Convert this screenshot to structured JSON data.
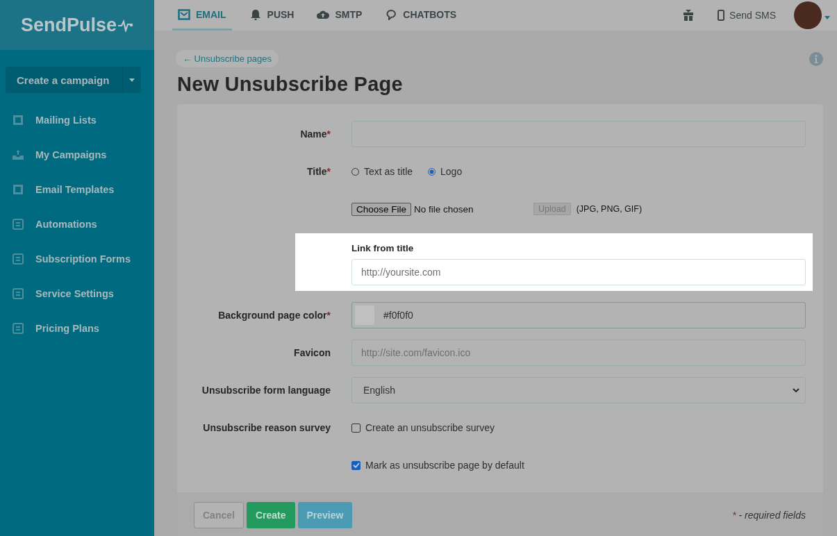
{
  "brand": {
    "name": "SendPulse"
  },
  "nav_tabs": [
    {
      "label": "EMAIL",
      "selected": true,
      "kind": "mail"
    },
    {
      "label": "PUSH",
      "selected": false,
      "kind": "bell"
    },
    {
      "label": "SMTP",
      "selected": false,
      "kind": "cloud"
    },
    {
      "label": "CHATBOTS",
      "selected": false,
      "kind": "chat"
    }
  ],
  "header": {
    "sms": "Send SMS"
  },
  "sidebar": {
    "create_button": "Create a campaign",
    "items": [
      {
        "label": "Mailing Lists",
        "kind": "lists"
      },
      {
        "label": "My Campaigns",
        "kind": "campaigns"
      },
      {
        "label": "Email Templates",
        "kind": "templates"
      },
      {
        "label": "Automations",
        "kind": "automations"
      },
      {
        "label": "Subscription Forms",
        "kind": "forms"
      },
      {
        "label": "Service Settings",
        "kind": "settings"
      },
      {
        "label": "Pricing Plans",
        "kind": "pricing"
      }
    ]
  },
  "breadcrumb": "← Unsubscribe pages",
  "title": "New Unsubscribe Page",
  "form": {
    "required_mark": "*",
    "rows": [
      {
        "kind": "text",
        "label": "Name",
        "required": true
      },
      {
        "kind": "radio",
        "label": "Title",
        "required": true,
        "options": [
          {
            "label": "Text as title",
            "selected": false
          },
          {
            "label": "Logo",
            "selected": true
          }
        ]
      },
      {
        "kind": "file",
        "choose": "Choose File",
        "status": "No file chosen",
        "upload": "Upload",
        "formats": "(JPG, PNG, GIF)"
      },
      {
        "kind": "link",
        "label": "Link from title",
        "placeholder": "http://yoursite.com",
        "highlighted": true
      },
      {
        "kind": "color",
        "label": "Background page color",
        "required": true,
        "value": "#f0f0f0"
      },
      {
        "kind": "text",
        "label": "Favicon",
        "placeholder": "http://site.com/favicon.ico"
      },
      {
        "kind": "select",
        "label": "Unsubscribe form language",
        "value": "English"
      },
      {
        "kind": "checkbox",
        "label": "Unsubscribe reason survey",
        "text": "Create an unsubscribe survey",
        "checked": false
      },
      {
        "kind": "checkbox",
        "text": "Mark as unsubscribe page by default",
        "checked": true
      }
    ]
  },
  "footer": {
    "buttons": [
      {
        "label": "Cancel",
        "kind": "cancel"
      },
      {
        "label": "Create",
        "kind": "primary"
      },
      {
        "label": "Preview",
        "kind": "secondary"
      }
    ],
    "note": "- required fields"
  }
}
